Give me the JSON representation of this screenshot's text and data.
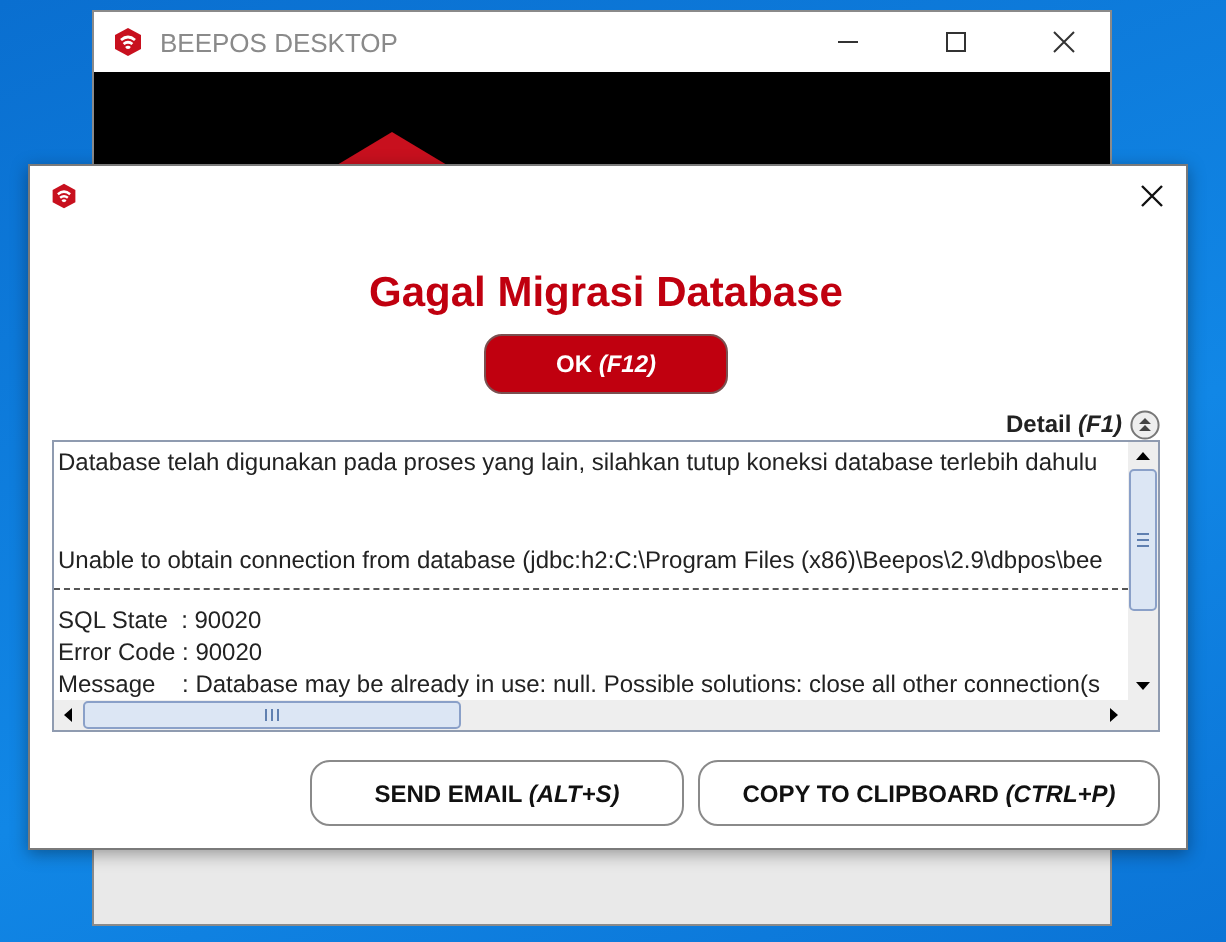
{
  "background_window": {
    "title": "BEEPOS DESKTOP"
  },
  "dialog": {
    "title": "Gagal Migrasi Database",
    "ok_button": "OK *(F12)*",
    "detail_toggle": "Detail *(F1)*",
    "detail_text": {
      "summary": "Database telah digunakan pada proses yang lain, silahkan tutup koneksi database terlebih dahulu",
      "cause": "Unable to obtain connection from database (jdbc:h2:C:\\Program Files (x86)\\Beepos\\2.9\\dbpos\\bee",
      "details": [
        "SQL State  : 90020",
        "Error Code : 90020",
        "Message    : Database may be already in use: null. Possible solutions: close all other connection(s"
      ]
    },
    "buttons": [
      "SEND EMAIL *(ALT+S)*",
      "COPY TO CLIPBOARD *(CTRL+P)*"
    ]
  }
}
